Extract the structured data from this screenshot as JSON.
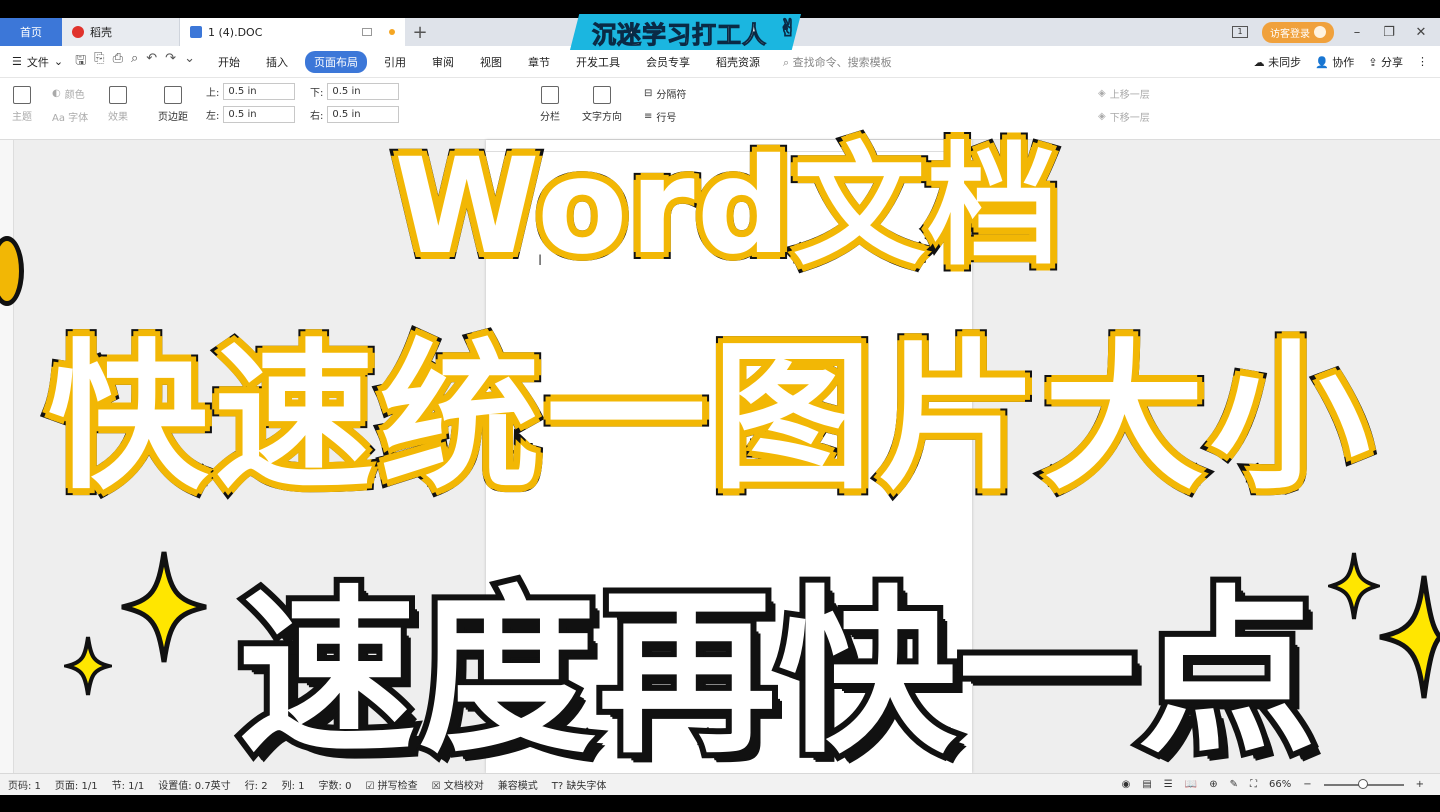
{
  "tabs": {
    "home": "首页",
    "daoke": "稻壳",
    "doc": "1 (4).DOC",
    "login": "访客登录",
    "page_indicator": "1"
  },
  "banner": "沉迷学习打工人",
  "menu": {
    "file": "文件",
    "tabs": [
      "开始",
      "插入",
      "页面布局",
      "引用",
      "审阅",
      "视图",
      "章节",
      "开发工具",
      "会员专享",
      "稻壳资源"
    ],
    "active_tab": "页面布局",
    "search": "查找命令、搜索模板",
    "right": [
      "未同步",
      "协作",
      "分享"
    ]
  },
  "ribbon": {
    "theme": "主题",
    "color": "颜色",
    "font": "Aa 字体",
    "effect": "效果",
    "margins": "页边距",
    "top_label": "上:",
    "top_value": "0.5 in",
    "bottom_label": "下:",
    "bottom_value": "0.5 in",
    "left_label": "左:",
    "left_value": "0.5 in",
    "right_label": "右:",
    "right_value": "0.5 in",
    "columns": "分栏",
    "text_direction": "文字方向",
    "breaks": "分隔符",
    "line_numbers": "行号",
    "bring_forward": "上移一层",
    "send_backward": "下移一层"
  },
  "overlay": {
    "line1": "Word文档",
    "line2": "快速统一图片大小",
    "line3": "速度再快一点"
  },
  "status": {
    "items": [
      "页码: 1",
      "页面: 1/1",
      "节: 1/1",
      "设置值: 0.7英寸",
      "行: 2",
      "列: 1",
      "字数: 0",
      "拼写检查",
      "文档校对",
      "兼容模式",
      "缺失字体"
    ],
    "zoom": "66%"
  },
  "colors": {
    "accent": "#3c77d8",
    "overlay_outline": "#f2b705",
    "banner": "#1bb6e0"
  }
}
